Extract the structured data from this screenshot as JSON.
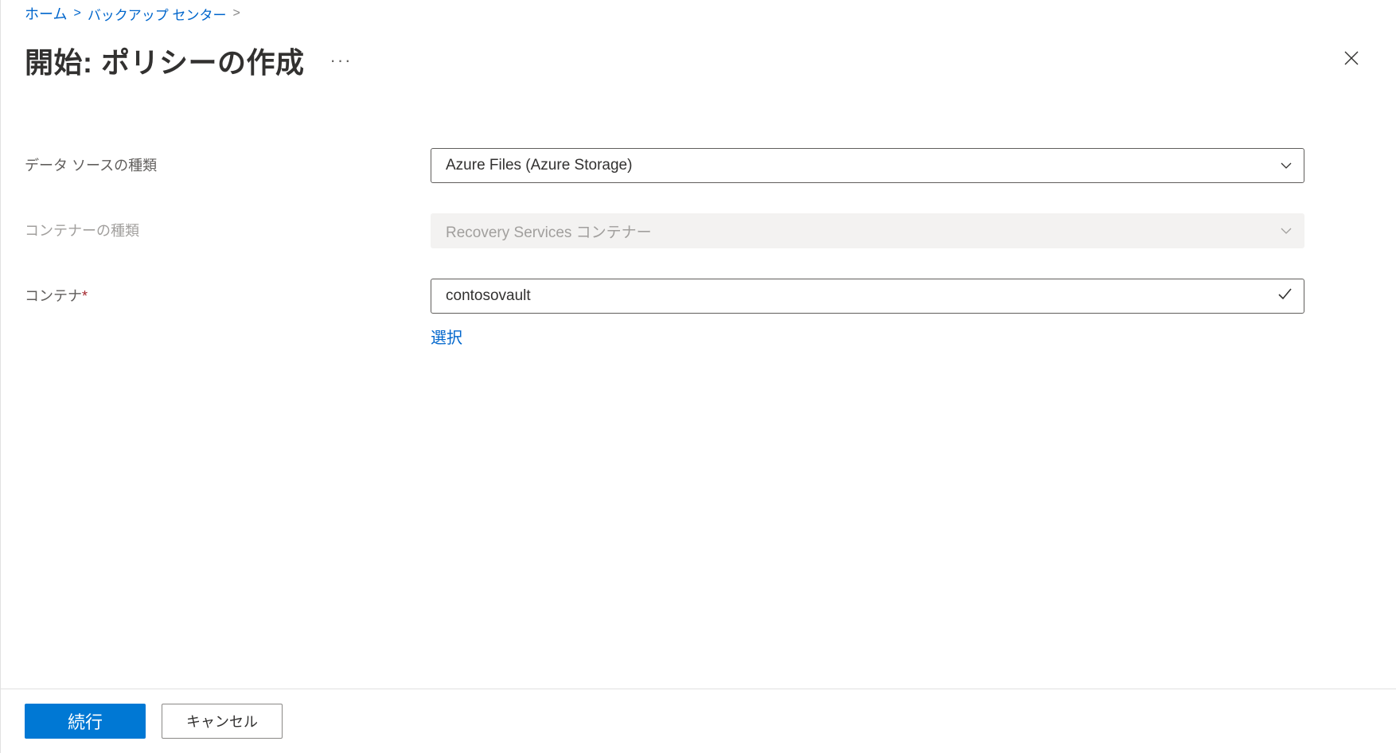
{
  "breadcrumb": {
    "home": "ホーム",
    "backup_center": "バックアップ センター"
  },
  "header": {
    "title": "開始: ポリシーの作成",
    "ellipsis": "···"
  },
  "form": {
    "datasource_type": {
      "label": "データ ソースの種類",
      "value": "Azure Files (Azure Storage)"
    },
    "container_type": {
      "label": "コンテナーの種類",
      "value": "Recovery Services コンテナー"
    },
    "container": {
      "label": "コンテナ",
      "required_marker": "*",
      "value": "contosovault",
      "select_link": "選択"
    }
  },
  "footer": {
    "continue": "続行",
    "cancel": "キャンセル"
  }
}
